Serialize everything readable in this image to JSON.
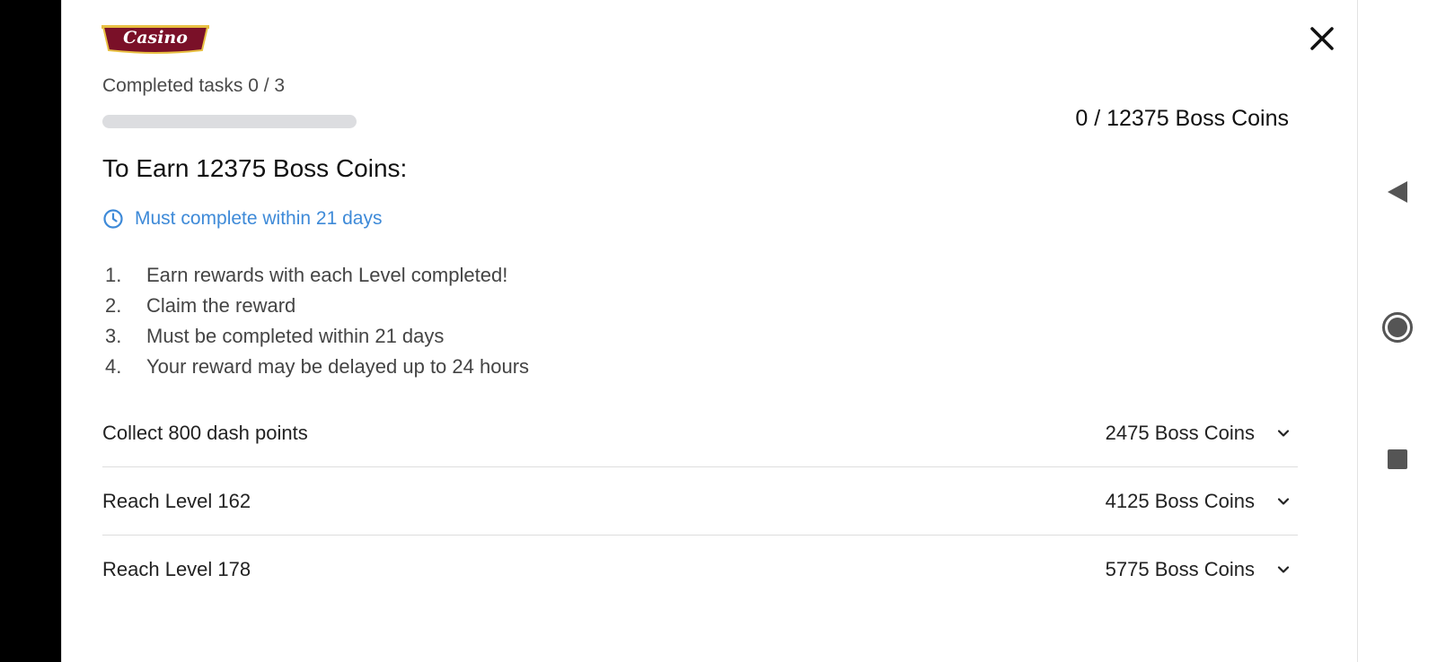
{
  "logo": {
    "text": "Casino"
  },
  "progress": {
    "completed_label": "Completed tasks 0 / 3",
    "fraction": 0,
    "coins_status": "0 / 12375 Boss Coins"
  },
  "offer": {
    "heading": "To Earn 12375 Boss Coins:",
    "deadline": "Must complete within 21 days"
  },
  "rules": [
    {
      "num": "1.",
      "text": "Earn rewards with each Level completed!"
    },
    {
      "num": "2.",
      "text": "Claim the reward"
    },
    {
      "num": "3.",
      "text": "Must be completed within 21 days"
    },
    {
      "num": "4.",
      "text": "Your reward may be delayed up to 24 hours"
    }
  ],
  "tasks": [
    {
      "name": "Collect 800 dash points",
      "reward": "2475 Boss Coins"
    },
    {
      "name": "Reach Level 162",
      "reward": "4125 Boss Coins"
    },
    {
      "name": "Reach Level 178",
      "reward": "5775 Boss Coins"
    }
  ],
  "icons": {
    "close": "close-icon",
    "clock": "clock-icon",
    "chevron": "chevron-down-icon",
    "back": "back-triangle-icon",
    "home": "home-circle-icon",
    "recents": "recents-square-icon"
  },
  "colors": {
    "accent": "#3e8ad8",
    "logo_bg": "#7a1028",
    "logo_gold": "#e8c043",
    "track": "#dcdde0"
  }
}
